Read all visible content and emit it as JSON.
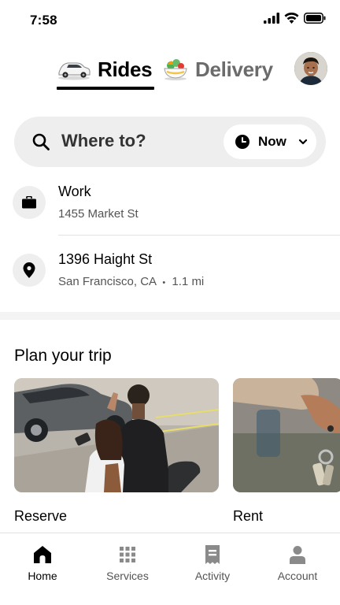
{
  "status_bar": {
    "time": "7:58",
    "icons": [
      "signal-icon",
      "wifi-icon",
      "battery-icon"
    ]
  },
  "top_tabs": {
    "active": "rides",
    "items": [
      {
        "id": "rides",
        "label": "Rides",
        "icon": "car-icon"
      },
      {
        "id": "delivery",
        "label": "Delivery",
        "icon": "food-bowl-icon"
      }
    ]
  },
  "search": {
    "placeholder": "Where to?",
    "time_option": "Now"
  },
  "saved_places": [
    {
      "title": "Work",
      "subtitle": "1455 Market St",
      "icon": "briefcase-icon"
    },
    {
      "title": "1396 Haight St",
      "subtitle": "San Francisco, CA",
      "distance": "1.1 mi",
      "separator": "•",
      "icon": "location-pin-icon"
    }
  ],
  "plan": {
    "title": "Plan your trip",
    "cards": [
      {
        "label": "Reserve"
      },
      {
        "label": "Rent"
      }
    ]
  },
  "bottom_nav": [
    {
      "label": "Home",
      "icon": "home-icon",
      "active": true
    },
    {
      "label": "Services",
      "icon": "grid-icon",
      "active": false
    },
    {
      "label": "Activity",
      "icon": "receipt-icon",
      "active": false
    },
    {
      "label": "Account",
      "icon": "person-icon",
      "active": false
    }
  ],
  "colors": {
    "accent": "#000000",
    "muted": "#6b6b6b",
    "chip_bg": "#eeeeee"
  }
}
